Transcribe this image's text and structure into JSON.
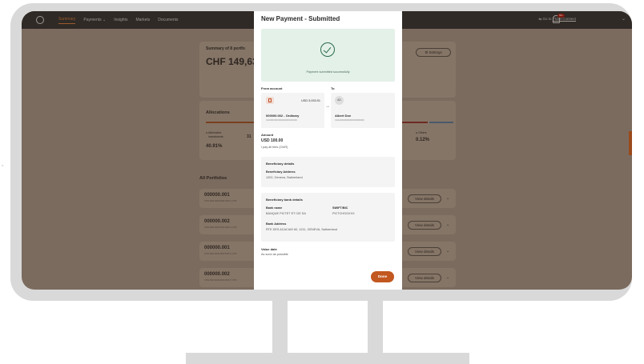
{
  "topbar": {
    "nav": [
      "Summary",
      "Payments ⌄",
      "Insights",
      "Markets",
      "Documents"
    ],
    "go_to": "Go to",
    "go_to_link": "Pictet Connect",
    "badge": "99+"
  },
  "dashboard": {
    "summary_title": "Summary of 8 portfo",
    "summary_value": "CHF 149,63",
    "settings_label": "⚙ Settings",
    "allocations_title": "Allocations",
    "alloc_label": "● Alternative\n   investments",
    "alloc_pct": "40.91%",
    "alloc_fragment": "31",
    "others_label": "● Others",
    "others_pct": "0.12%",
    "all_portfolios": "All Portfolios",
    "rows": [
      {
        "title": "000000.001",
        "sub": "CH11 0000 0000 0000 0000 0 | CHF"
      },
      {
        "title": "000000.002",
        "sub": "CH11 0000 0000 0000 0000 0 | CHF"
      },
      {
        "title": "000000.001",
        "sub": "CH11 0000 0000 0000 0000 0 | CHF"
      },
      {
        "title": "000000.002",
        "sub": "CH11 0000 0000 0000 0000 0 | CHF"
      }
    ],
    "view_details": "View details"
  },
  "modal": {
    "title": "New Payment - Submitted",
    "success_text": "Payment submitted successfully",
    "from_label": "From account",
    "to_label": "To",
    "from_balance": "USD 5,933.91",
    "from_name": "000000.002 - Ordinary",
    "from_iban": "CH000000000000000000000",
    "to_initials": "AD",
    "to_name": "Albert Doe",
    "to_iban": "CH140000000000000000000",
    "amount_label": "Amount",
    "amount_value": "USD 100.00",
    "fees": "I pay all fees (OUR)",
    "beneficiary_title": "Beneficiary details",
    "beneficiary_address_label": "Beneficiary Address",
    "beneficiary_address": "1202, Geneva, Switzerland",
    "bank_title": "Beneficiary bank details",
    "bank_name_label": "Bank name",
    "bank_name": "BANQUE PICTET ET CIE SA",
    "swift_label": "SWIFT/BIC",
    "swift": "PICTCHGGXXX",
    "bank_address_label": "Bank Address",
    "bank_address": "RTE DES ACACIAS 60, 1211, GENEVA, Switzerland",
    "value_date_label": "Value date",
    "value_date": "As soon as possible",
    "done_label": "Done"
  },
  "side_mark": "<"
}
